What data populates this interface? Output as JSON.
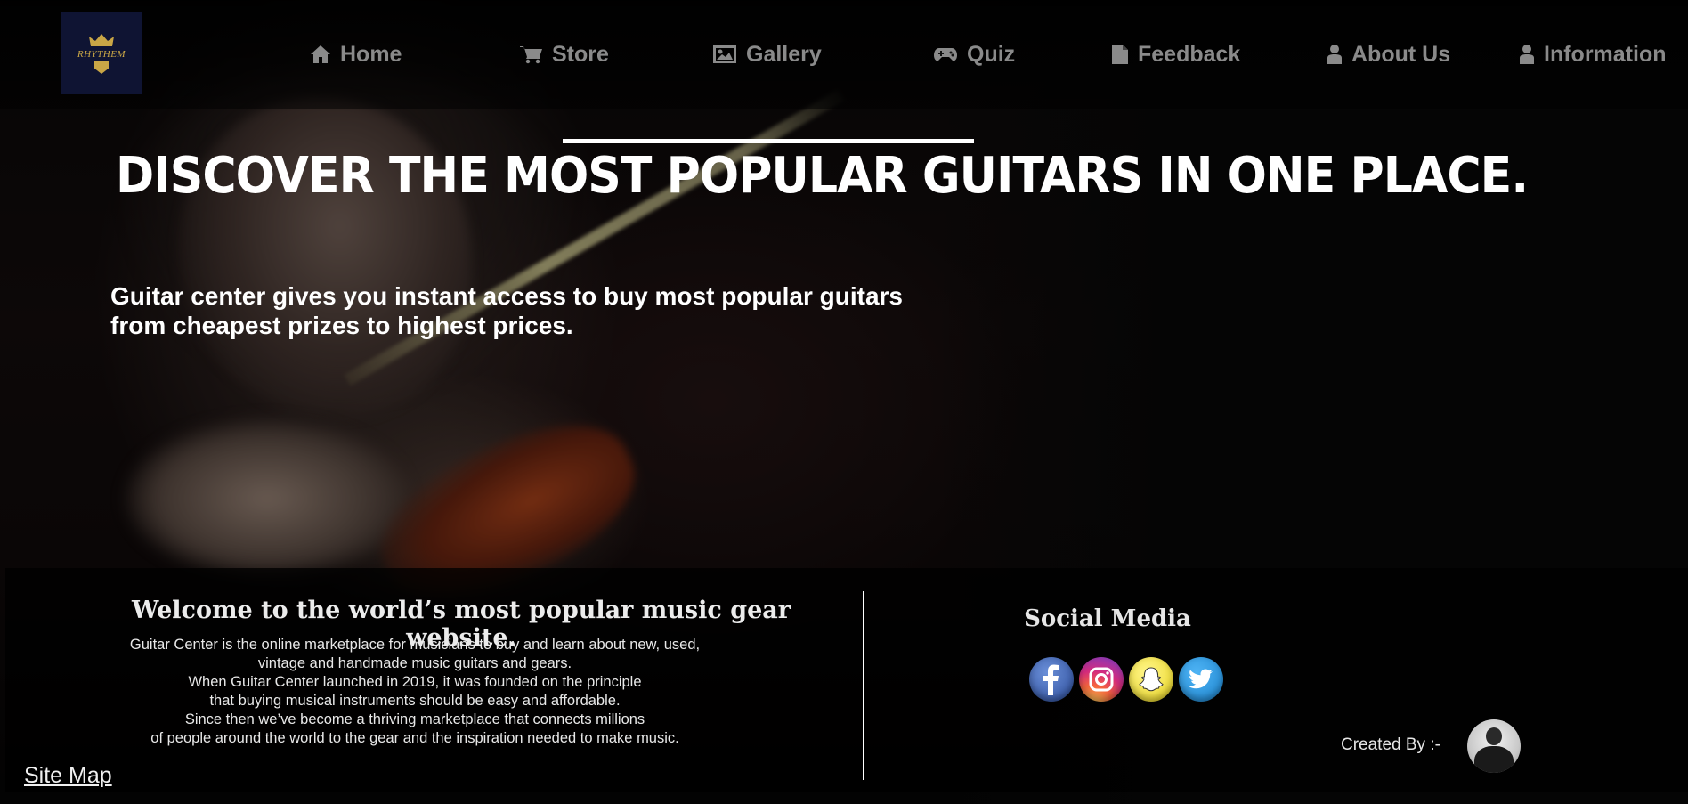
{
  "brand": {
    "logo_text": "RHYTHEM",
    "logo_icon": "crown-icon",
    "logo_color": "#c9a646",
    "logo_bg": "#0f1433"
  },
  "nav": {
    "items": [
      {
        "label": "Home",
        "icon": "home-icon"
      },
      {
        "label": "Store",
        "icon": "cart-icon"
      },
      {
        "label": "Gallery",
        "icon": "image-icon"
      },
      {
        "label": "Quiz",
        "icon": "gamepad-icon"
      },
      {
        "label": "Feedback",
        "icon": "file-icon"
      },
      {
        "label": "About Us",
        "icon": "user-icon"
      },
      {
        "label": "Information",
        "icon": "user-icon"
      }
    ],
    "text_color": "#8a8a8a"
  },
  "hero": {
    "title": "DISCOVER THE MOST POPULAR GUITARS IN ONE PLACE.",
    "subtitle_line1": "Guitar center gives you instant access to buy most popular guitars",
    "subtitle_line2": "from cheapest prizes to highest prices."
  },
  "footer": {
    "heading": "Welcome to the world’s most popular music gear website.",
    "body_lines": [
      "Guitar Center is the online marketplace for musicians to buy and learn about new, used,",
      "vintage and handmade music guitars and gears.",
      "When Guitar Center launched in 2019, it was founded on the principle",
      "that buying musical instruments should be easy and affordable.",
      "Since then we’ve become a thriving marketplace that connects millions",
      "of people around the world to the gear and the inspiration needed to make music."
    ],
    "social_title": "Social Media",
    "social": [
      {
        "name": "Facebook",
        "icon": "facebook-icon",
        "color": "#3b5998"
      },
      {
        "name": "Instagram",
        "icon": "instagram-icon",
        "color": "#d42b7d"
      },
      {
        "name": "Snapchat",
        "icon": "snapchat-icon",
        "color": "#fffc00"
      },
      {
        "name": "Twitter",
        "icon": "twitter-icon",
        "color": "#1da1f2"
      }
    ],
    "created_by": "Created By :-",
    "sitemap": "Site Map"
  }
}
